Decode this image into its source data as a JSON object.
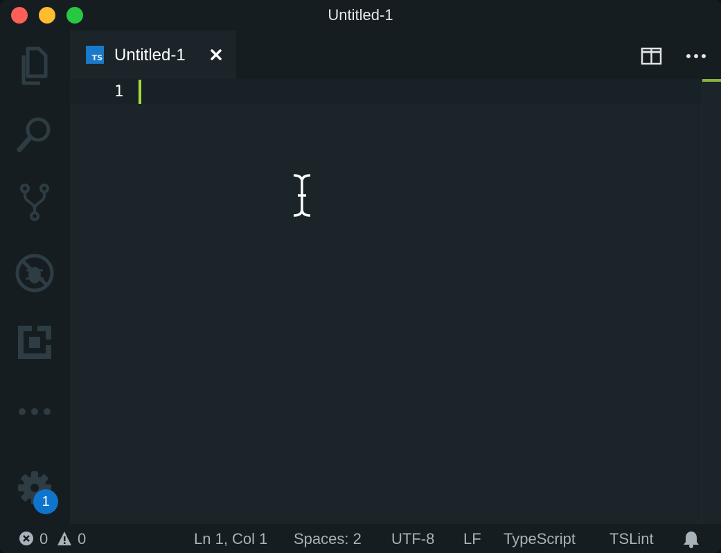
{
  "window": {
    "title": "Untitled-1"
  },
  "activity_bar": {
    "items": [
      {
        "name": "explorer",
        "icon": "files-icon"
      },
      {
        "name": "search",
        "icon": "search-icon"
      },
      {
        "name": "source-control",
        "icon": "source-control-icon"
      },
      {
        "name": "debug",
        "icon": "debug-icon"
      },
      {
        "name": "extensions",
        "icon": "extensions-icon"
      },
      {
        "name": "more",
        "icon": "more-icon"
      }
    ],
    "manage": {
      "icon": "gear-icon",
      "badge": "1"
    }
  },
  "tabs": [
    {
      "label": "Untitled-1",
      "icon_text": "TS",
      "icon": "typescript-icon",
      "active": true
    }
  ],
  "editor": {
    "lines": [
      {
        "number": "1",
        "text": ""
      }
    ]
  },
  "status_bar": {
    "errors": "0",
    "warnings": "0",
    "position": "Ln 1, Col 1",
    "indentation": "Spaces: 2",
    "encoding": "UTF-8",
    "line_ending": "LF",
    "language": "TypeScript",
    "linter": "TSLint"
  },
  "colors": {
    "background": "#1b2429",
    "chrome": "#151d21",
    "accent": "#a7d93d",
    "badge": "#0f74cc",
    "typescript": "#1a7ac9"
  }
}
